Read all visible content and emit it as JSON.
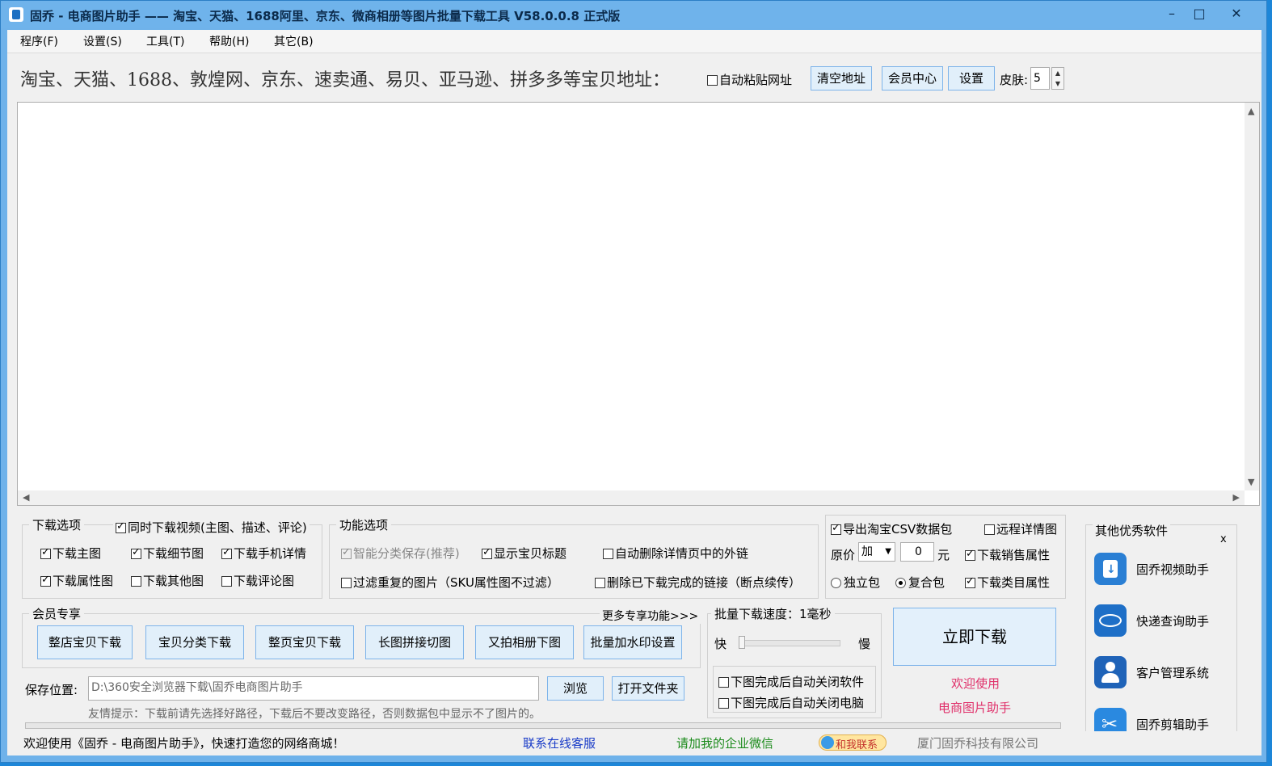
{
  "window": {
    "title": "固乔 - 电商图片助手 —— 淘宝、天猫、1688阿里、京东、微商相册等图片批量下载工具 V58.0.0.8 正式版",
    "minimize": "–",
    "maximize": "□",
    "close": "✕"
  },
  "menu": [
    "程序(F)",
    "设置(S)",
    "工具(T)",
    "帮助(H)",
    "其它(B)"
  ],
  "url_row": {
    "label": "淘宝、天猫、1688、敦煌网、京东、速卖通、易贝、亚马逊、拼多多等宝贝地址：",
    "auto_paste": "自动粘贴网址",
    "clear_btn": "清空地址",
    "member_btn": "会员中心",
    "settings_btn": "设置",
    "skin_label": "皮肤:",
    "skin_value": "5"
  },
  "download_options": {
    "title": "下载选项",
    "video": "同时下载视频(主图、描述、评论)",
    "items": [
      {
        "label": "下载主图",
        "checked": true
      },
      {
        "label": "下载细节图",
        "checked": true
      },
      {
        "label": "下载手机详情",
        "checked": true
      },
      {
        "label": "下载属性图",
        "checked": true
      },
      {
        "label": "下载其他图",
        "checked": false
      },
      {
        "label": "下载评论图",
        "checked": false
      }
    ]
  },
  "function_options": {
    "title": "功能选项",
    "smart_save": "智能分类保存(推荐)",
    "show_title": "显示宝贝标题",
    "auto_delete": "自动删除详情页中的外链",
    "filter_dup": "过滤重复的图片（SKU属性图不过滤）",
    "delete_done": "删除已下载完成的链接（断点续传）"
  },
  "csv": {
    "export": "导出淘宝CSV数据包",
    "remote": "远程详情图",
    "price_label": "原价",
    "price_op": "加",
    "price_value": "0",
    "unit": "元",
    "sales_attr": "下载销售属性",
    "standalone": "独立包",
    "composite": "复合包",
    "category_attr": "下载类目属性"
  },
  "member": {
    "title": "会员专享",
    "more": "更多专享功能>>>",
    "buttons": [
      "整店宝贝下载",
      "宝贝分类下载",
      "整页宝贝下载",
      "长图拼接切图",
      "又拍相册下图",
      "批量加水印设置"
    ]
  },
  "speed": {
    "title": "批量下载速度：1毫秒",
    "fast": "快",
    "slow": "慢",
    "close_app": "下图完成后自动关闭软件",
    "shutdown": "下图完成后自动关闭电脑"
  },
  "download_now": "立即下载",
  "welcome1": "欢迎使用",
  "welcome2": "电商图片助手",
  "save": {
    "label": "保存位置:",
    "path": "D:\\360安全浏览器下载\\固乔电商图片助手",
    "browse": "浏览",
    "open_folder": "打开文件夹",
    "tip": "友情提示：下载前请先选择好路径，下载后不要改变路径，否则数据包中显示不了图片的。"
  },
  "other_software": {
    "title": "其他优秀软件",
    "close": "x",
    "items": [
      {
        "name": "固乔视频助手",
        "icon": "video-download-icon"
      },
      {
        "name": "快递查询助手",
        "icon": "express-search-icon"
      },
      {
        "name": "客户管理系统",
        "icon": "customer-icon"
      },
      {
        "name": "固乔剪辑助手",
        "icon": "scissors-icon"
      }
    ]
  },
  "status": {
    "welcome": "欢迎使用《固乔 - 电商图片助手》，快速打造您的网络商城！",
    "service": "联系在线客服",
    "wechat": "请加我的企业微信",
    "contact": "和我联系",
    "company": "厦门固乔科技有限公司"
  },
  "colors": {
    "titlebar": "#6fb3eb",
    "link_blue": "#1a3cc8",
    "link_green": "#1a8a1a",
    "welcome_red": "#e0306a"
  }
}
